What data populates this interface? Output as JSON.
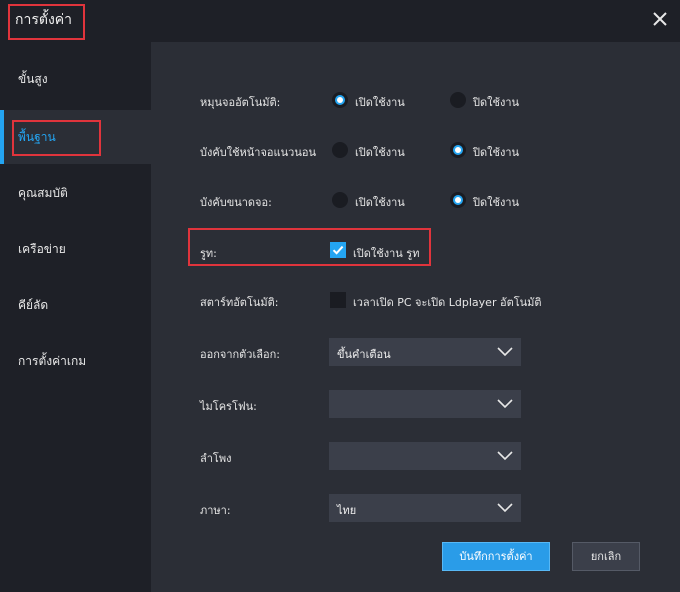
{
  "window": {
    "title": "การตั้งค่า"
  },
  "sidebar": {
    "items": [
      {
        "label": "ขั้นสูง"
      },
      {
        "label": "พื้นฐาน"
      },
      {
        "label": "คุณสมบัติ"
      },
      {
        "label": "เครือข่าย"
      },
      {
        "label": "คีย์ลัด"
      },
      {
        "label": "การตั้งค่าเกม"
      }
    ]
  },
  "settings": {
    "auto_rotate": {
      "label": "หมุนจออัตโนมัติ:",
      "on_label": "เปิดใช้งาน",
      "off_label": "ปิดใช้งาน"
    },
    "force_landscape": {
      "label": "บังคับใช้หน้าจอแนวนอน",
      "on_label": "เปิดใช้งาน",
      "off_label": "ปิดใช้งาน"
    },
    "force_size": {
      "label": "บังคับขนาดจอ:",
      "on_label": "เปิดใช้งาน",
      "off_label": "ปิดใช้งาน"
    },
    "root": {
      "label": "รูท:",
      "checkbox_label": "เปิดใช้งาน รูท"
    },
    "autostart": {
      "label": "สตาร์ทอัตโนมัติ:",
      "checkbox_label": "เวลาเปิด PC จะเปิด Ldplayer อัตโนมัติ"
    },
    "exit_option": {
      "label": "ออกจากตัวเลือก:",
      "value": "ขึ้นคำเตือน"
    },
    "microphone": {
      "label": "ไมโครโฟน:",
      "value": ""
    },
    "speaker": {
      "label": "ลำโพง",
      "value": ""
    },
    "language": {
      "label": "ภาษา:",
      "value": "ไทย"
    }
  },
  "buttons": {
    "save": "บันทึกการตั้งค่า",
    "cancel": "ยกเลิก"
  },
  "colors": {
    "accent": "#24a5f2",
    "highlight": "#e0343c",
    "panel": "#2b2e36",
    "background": "#1e2027"
  }
}
